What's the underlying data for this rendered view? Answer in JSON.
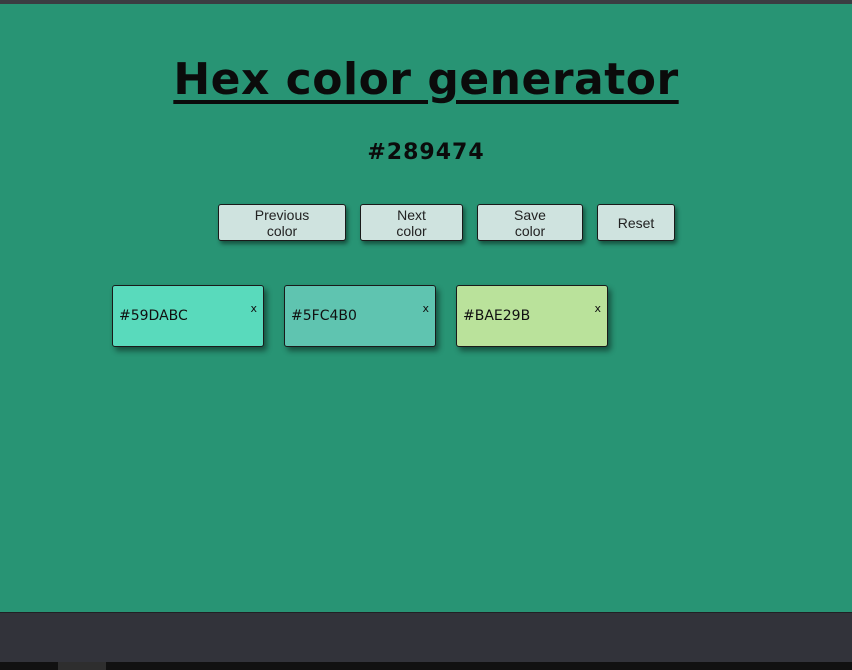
{
  "app": {
    "title": "Hex color generator",
    "current_hex": "#289474",
    "background_color": "#289474"
  },
  "controls": {
    "previous_label": "Previous color",
    "next_label": "Next color",
    "save_label": "Save color",
    "reset_label": "Reset"
  },
  "saved_colors": [
    {
      "hex": "#59DABC",
      "close": "x",
      "color": "#59DABC"
    },
    {
      "hex": "#5FC4B0",
      "close": "x",
      "color": "#5FC4B0"
    },
    {
      "hex": "#BAE29B",
      "close": "x",
      "color": "#BAE29B"
    }
  ]
}
